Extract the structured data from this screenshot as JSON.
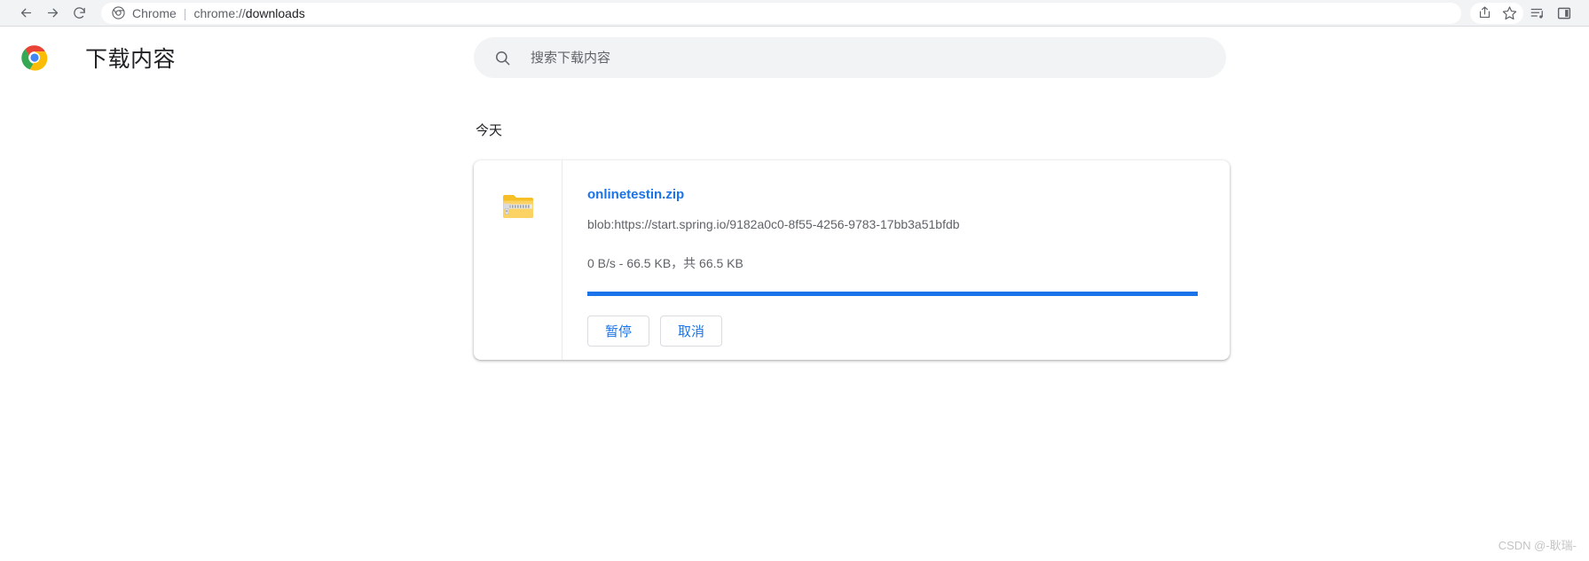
{
  "browser": {
    "back_label": "Back",
    "forward_label": "Forward",
    "reload_label": "Reload",
    "omnibox": {
      "scheme_label": "Chrome",
      "separator": "|",
      "url": "chrome://downloads",
      "url_scheme_part": "chrome://",
      "url_host_part": "downloads"
    },
    "actions": [
      {
        "name": "share-icon",
        "label": "Share"
      },
      {
        "name": "star-icon",
        "label": "Bookmark this tab"
      },
      {
        "name": "media-control-icon",
        "label": "Media controls"
      },
      {
        "name": "side-panel-icon",
        "label": "Side panel"
      }
    ]
  },
  "header": {
    "logo_name": "chrome-logo",
    "title": "下载内容"
  },
  "search": {
    "placeholder": "搜索下载内容",
    "value": "",
    "icon": "search-icon"
  },
  "downloads": {
    "date_heading": "今天",
    "items": [
      {
        "file_icon": "zip-folder-icon",
        "filename": "onlinetestin.zip",
        "url": "blob:https://start.spring.io/9182a0c0-8f55-4256-9783-17bb3a51bfdb",
        "status": "0 B/s - 66.5 KB，共 66.5 KB",
        "progress_percent": 100,
        "buttons": [
          {
            "name": "pause-button",
            "label": "暂停"
          },
          {
            "name": "cancel-button",
            "label": "取消"
          }
        ]
      }
    ]
  },
  "watermark": {
    "text": "CSDN @-耿瑞-"
  },
  "colors": {
    "accent": "#1a73e8",
    "toolbar_bg": "#f1f3f4",
    "text_primary": "#202124",
    "text_secondary": "#5f6368"
  }
}
